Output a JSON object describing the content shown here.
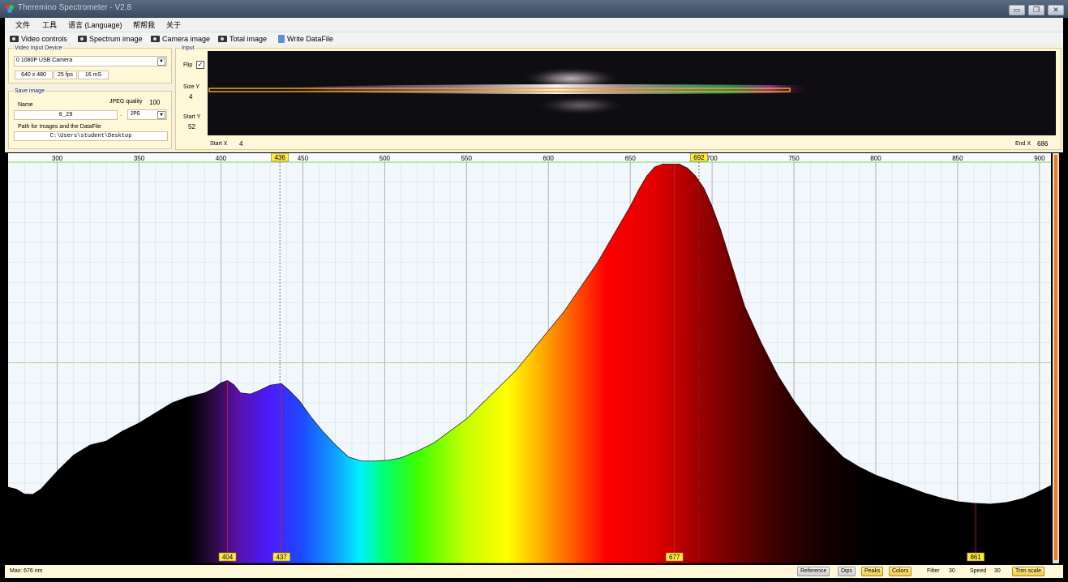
{
  "window": {
    "title": "Theremino Spectrometer - V2.8"
  },
  "menu": [
    "文件",
    "工具",
    "语言 (Language)",
    "帮帮我",
    "关于"
  ],
  "toolbar": {
    "video_controls": "Video controls",
    "spectrum_image": "Spectrum image",
    "camera_image": "Camera image",
    "total_image": "Total image",
    "write_datafile": "Write DataFile"
  },
  "video_input": {
    "title": "Video Input Device",
    "device": "0 1080P USB Camera",
    "resolution": "640 x 480",
    "fps": "25 fps",
    "exposure": "16 mS"
  },
  "save_image": {
    "title": "Save image",
    "name_label": "Name",
    "jpeg_quality_label": "JPEG quality",
    "jpeg_quality": "100",
    "name_value": "0_29",
    "dot": ".",
    "format": "JPG",
    "path_label": "Path for Images and the DataFile",
    "path": "C:\\Users\\student\\Desktop"
  },
  "input": {
    "title": "Input",
    "flip_label": "Flip",
    "flip_checked": true,
    "size_y_label": "Size Y",
    "size_y": "4",
    "start_y_label": "Start Y",
    "start_y": "52",
    "start_x_label": "Start X",
    "start_x": "4",
    "end_x_label": "End X",
    "end_x": "686"
  },
  "chart_data": {
    "type": "area",
    "xlabel": "",
    "ylabel": "",
    "xlim": [
      270,
      907
    ],
    "ylim": [
      0,
      100
    ],
    "x_ticks": [
      300,
      350,
      400,
      450,
      500,
      550,
      600,
      650,
      700,
      750,
      800,
      850,
      900
    ],
    "cursor_labels": [
      "436",
      "692"
    ],
    "peak_labels": [
      "404",
      "437",
      "677",
      "861"
    ],
    "grid": true,
    "series": [
      {
        "x": [
          270,
          275,
          280,
          285,
          290,
          300,
          310,
          320,
          330,
          340,
          350,
          360,
          370,
          380,
          390,
          395,
          400,
          404,
          408,
          412,
          418,
          424,
          430,
          437,
          442,
          448,
          455,
          462,
          470,
          478,
          486,
          494,
          502,
          510,
          520,
          530,
          540,
          550,
          560,
          570,
          580,
          590,
          600,
          610,
          620,
          630,
          640,
          650,
          655,
          660,
          665,
          670,
          675,
          680,
          685,
          690,
          695,
          700,
          705,
          710,
          715,
          720,
          730,
          740,
          750,
          760,
          770,
          780,
          790,
          800,
          810,
          820,
          830,
          840,
          850,
          860,
          870,
          880,
          890,
          900,
          907
        ],
        "y": [
          19,
          18.5,
          17.3,
          17.2,
          18.5,
          23,
          27,
          29.5,
          30.5,
          33,
          35,
          37.5,
          40,
          41.5,
          42.5,
          43.5,
          45,
          45.6,
          44.5,
          42.5,
          42.2,
          43.2,
          44.4,
          44.8,
          43,
          40.5,
          36.5,
          33,
          29.5,
          26.5,
          25.5,
          25.5,
          25.7,
          26.3,
          28,
          30,
          33,
          36,
          40,
          44,
          48,
          53,
          58,
          63,
          69,
          75,
          82,
          89,
          93,
          96.5,
          98.8,
          99.5,
          99.5,
          99.5,
          98.5,
          96.5,
          93.5,
          89,
          83.5,
          77,
          70.5,
          64,
          55,
          47,
          40.5,
          35,
          30.5,
          26.5,
          24,
          22,
          20.5,
          19,
          17.5,
          16.3,
          15.4,
          15,
          14.8,
          15.2,
          16.2,
          18,
          19.4
        ]
      }
    ]
  },
  "bottom": {
    "max_readout": "Max: 676 nm",
    "reference": "Reference",
    "dips": "Dips",
    "peaks": "Peaks",
    "colors": "Colors",
    "filter_label": "Filter",
    "filter": "30",
    "speed_label": "Speed",
    "speed": "30",
    "trim_scale": "Trim scale"
  }
}
